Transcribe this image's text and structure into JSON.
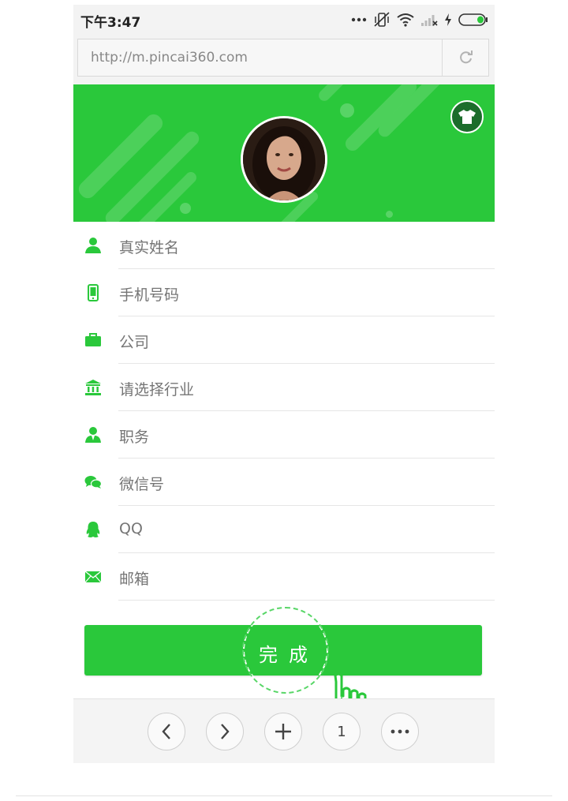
{
  "status_bar": {
    "time": "下午3:47"
  },
  "browser": {
    "url": "http://m.pincai360.com"
  },
  "form": {
    "fields": [
      {
        "icon": "person-icon",
        "placeholder": "真实姓名"
      },
      {
        "icon": "mobile-phone-icon",
        "placeholder": "手机号码"
      },
      {
        "icon": "briefcase-icon",
        "placeholder": "公司"
      },
      {
        "icon": "bank-icon",
        "placeholder": "请选择行业"
      },
      {
        "icon": "person-tie-icon",
        "placeholder": "职务"
      },
      {
        "icon": "wechat-icon",
        "placeholder": "微信号"
      },
      {
        "icon": "qq-penguin-icon",
        "placeholder": "QQ"
      },
      {
        "icon": "envelope-icon",
        "placeholder": "邮箱"
      }
    ],
    "submit_label": "完成"
  },
  "bottom_nav": {
    "page_count": "1"
  },
  "colors": {
    "accent": "#2ac83b",
    "shirt_button": "#1c6d2b"
  }
}
